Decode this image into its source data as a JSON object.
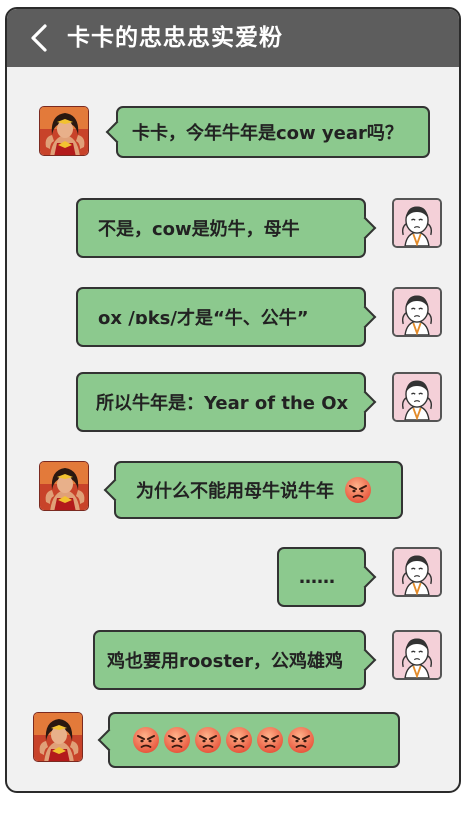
{
  "header": {
    "title": "卡卡的忠忠忠实爱粉",
    "back_icon": "chevron-left-icon"
  },
  "colors": {
    "header_bg": "#5d5d5d",
    "bubble_green": "#8cc98e",
    "chat_bg": "#f1f1f1"
  },
  "messages": [
    {
      "sender": "left",
      "avatar": "superhero-avatar",
      "text": "卡卡，今年牛年是cow year吗？"
    },
    {
      "sender": "right",
      "avatar": "cartoon-girl-avatar",
      "text": "不是，cow是奶牛，母牛"
    },
    {
      "sender": "right",
      "avatar": "cartoon-girl-avatar",
      "text": "ox /ɒks/才是“牛、公牛”"
    },
    {
      "sender": "right",
      "avatar": "cartoon-girl-avatar",
      "text": "所以牛年是：Year of the Ox"
    },
    {
      "sender": "left",
      "avatar": "superhero-avatar",
      "text": "为什么不能用母牛说牛年",
      "emoji": "angry-face-icon"
    },
    {
      "sender": "right",
      "avatar": "cartoon-girl-avatar",
      "text": "……"
    },
    {
      "sender": "right",
      "avatar": "cartoon-girl-avatar",
      "text": "鸡也要用rooster，公鸡雄鸡"
    },
    {
      "sender": "left",
      "avatar": "superhero-avatar",
      "text": "",
      "emoji_count": 6,
      "emoji": "angry-face-icon"
    }
  ]
}
